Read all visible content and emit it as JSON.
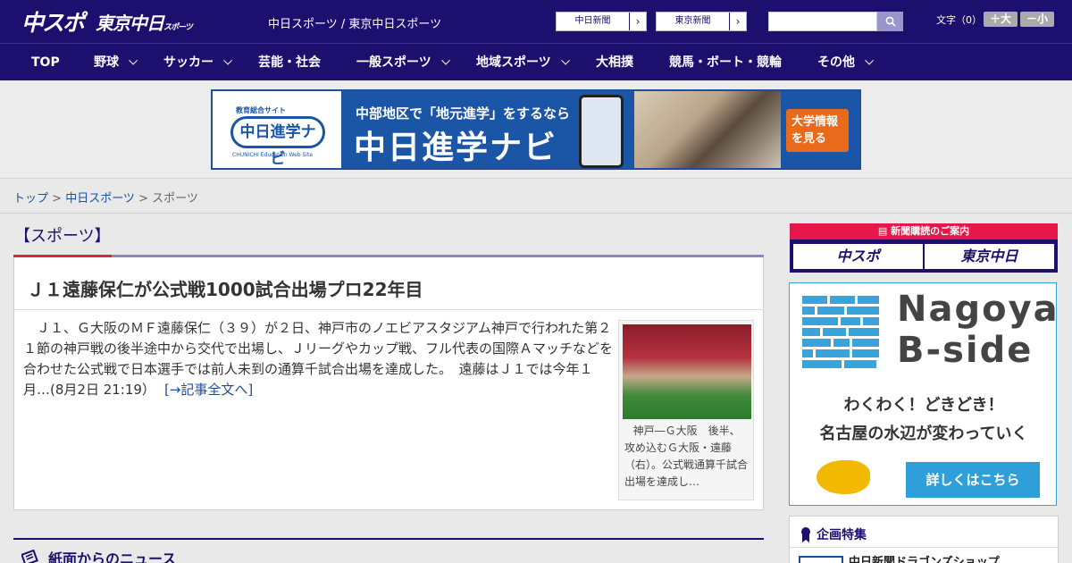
{
  "header": {
    "logo_chuspo": "中スポ",
    "logo_tokyo": "東京中日",
    "logo_tokyo_sub": "スポーツ",
    "site_links": [
      "中日スポーツ",
      " / ",
      "東京中日スポーツ"
    ],
    "paper_buttons": [
      "中日新聞",
      "東京新聞"
    ],
    "search_placeholder": "",
    "font_label": "文字（0）",
    "font_bigger": "＋大",
    "font_smaller": "－小"
  },
  "nav": {
    "items": [
      {
        "label": "TOP",
        "dropdown": false
      },
      {
        "label": "野球",
        "dropdown": true
      },
      {
        "label": "サッカー",
        "dropdown": true
      },
      {
        "label": "芸能・社会",
        "dropdown": false
      },
      {
        "label": "一般スポーツ",
        "dropdown": true
      },
      {
        "label": "地域スポーツ",
        "dropdown": true
      },
      {
        "label": "大相撲",
        "dropdown": false
      },
      {
        "label": "競馬・ボート・競輪",
        "dropdown": false
      },
      {
        "label": "その他",
        "dropdown": true
      }
    ]
  },
  "banner": {
    "logo_sub": "教育総合サイト",
    "logo_main": "中日進学ナビ",
    "logo_en": "CHUNICHI Education Web Site",
    "copy1": "中部地区で「地元進学」をするなら",
    "copy2": "中日進学ナビ",
    "cta": "大学情報を見る"
  },
  "breadcrumb": {
    "items": [
      "トップ",
      "中日スポーツ"
    ],
    "separator": " > ",
    "current": "スポーツ"
  },
  "category": {
    "title": "【スポーツ】"
  },
  "article": {
    "headline": "Ｊ１遠藤保仁が公式戦1000試合出場プロ22年目",
    "body": "Ｊ１、Ｇ大阪のＭＦ遠藤保仁（３９）が２日、神戸市のノエビアスタジアム神戸で行われた第２１節の神戸戦の後半途中から交代で出場し、Ｊリーグやカップ戦、フル代表の国際Ａマッチなどを合わせた公式戦で日本選手では前人未到の通算千試合出場を達成した。　遠藤はＪ１では今年１月…(8月2日 21:19）",
    "more_link": "[→記事全文へ]",
    "photo_caption": "神戸―Ｇ大阪　後半、攻め込むＧ大阪・遠藤（右）。公式戦通算千試合出場を達成し…"
  },
  "news_section": {
    "title": "紙面からのニュース"
  },
  "sidebar": {
    "subscription_head": "新聞購読のご案内",
    "subscription_buttons": [
      "中スポ",
      "東京中日"
    ],
    "ad": {
      "name_line1": "Nagoya",
      "name_line2": "B-side",
      "tag1": "わくわく！どきどき！",
      "tag2": "名古屋の水辺が変わっていく",
      "cta": "詳しくはこちら"
    },
    "feature": {
      "title": "企画特集",
      "item": "中日新聞ドラゴンズショップ"
    }
  },
  "colors": {
    "brand_navy": "#1c0f6e",
    "accent_red": "#d8263a",
    "link_blue": "#1c4fa0",
    "ad_blue": "#2e9fd8"
  }
}
